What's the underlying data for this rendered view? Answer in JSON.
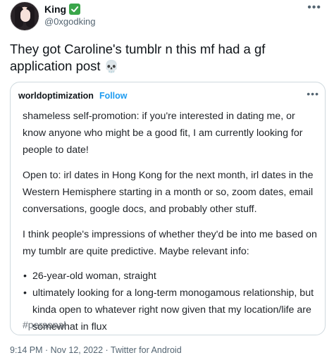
{
  "author": {
    "display_name": "King",
    "handle": "@0xgodking",
    "verified_emoji": "✅"
  },
  "tweet": {
    "text_line1": "They got Caroline's tumblr n this mf had a gf",
    "text_line2": "application post",
    "emoji": "💀"
  },
  "quoted_post": {
    "blog_name": "worldoptimization",
    "follow_label": "Follow",
    "paragraphs": [
      "shameless self-promotion: if you're interested in dating me, or know anyone who might be a good fit, I am currently looking for people to date!",
      "Open to: irl dates in Hong Kong for the next month, irl dates in the Western Hemisphere starting in a month or so, zoom dates, email conversations, google docs, and probably other stuff.",
      "I think people's impressions of whether they'd be into me based on my tumblr are quite predictive. Maybe relevant info:"
    ],
    "bullets": [
      "26-year-old woman, straight",
      "ultimately looking for a long-term monogamous relationship, but kinda open to whatever right now given that my location/life are somewhat in flux"
    ],
    "tag": "#personal"
  },
  "meta": {
    "timestamp": "9:14 PM · Nov 12, 2022 · Twitter for Android"
  },
  "colors": {
    "follow_blue": "#1d9bf0",
    "verified_green": "#3aa64a",
    "secondary_text": "#536471",
    "card_border": "#cfd9de"
  }
}
